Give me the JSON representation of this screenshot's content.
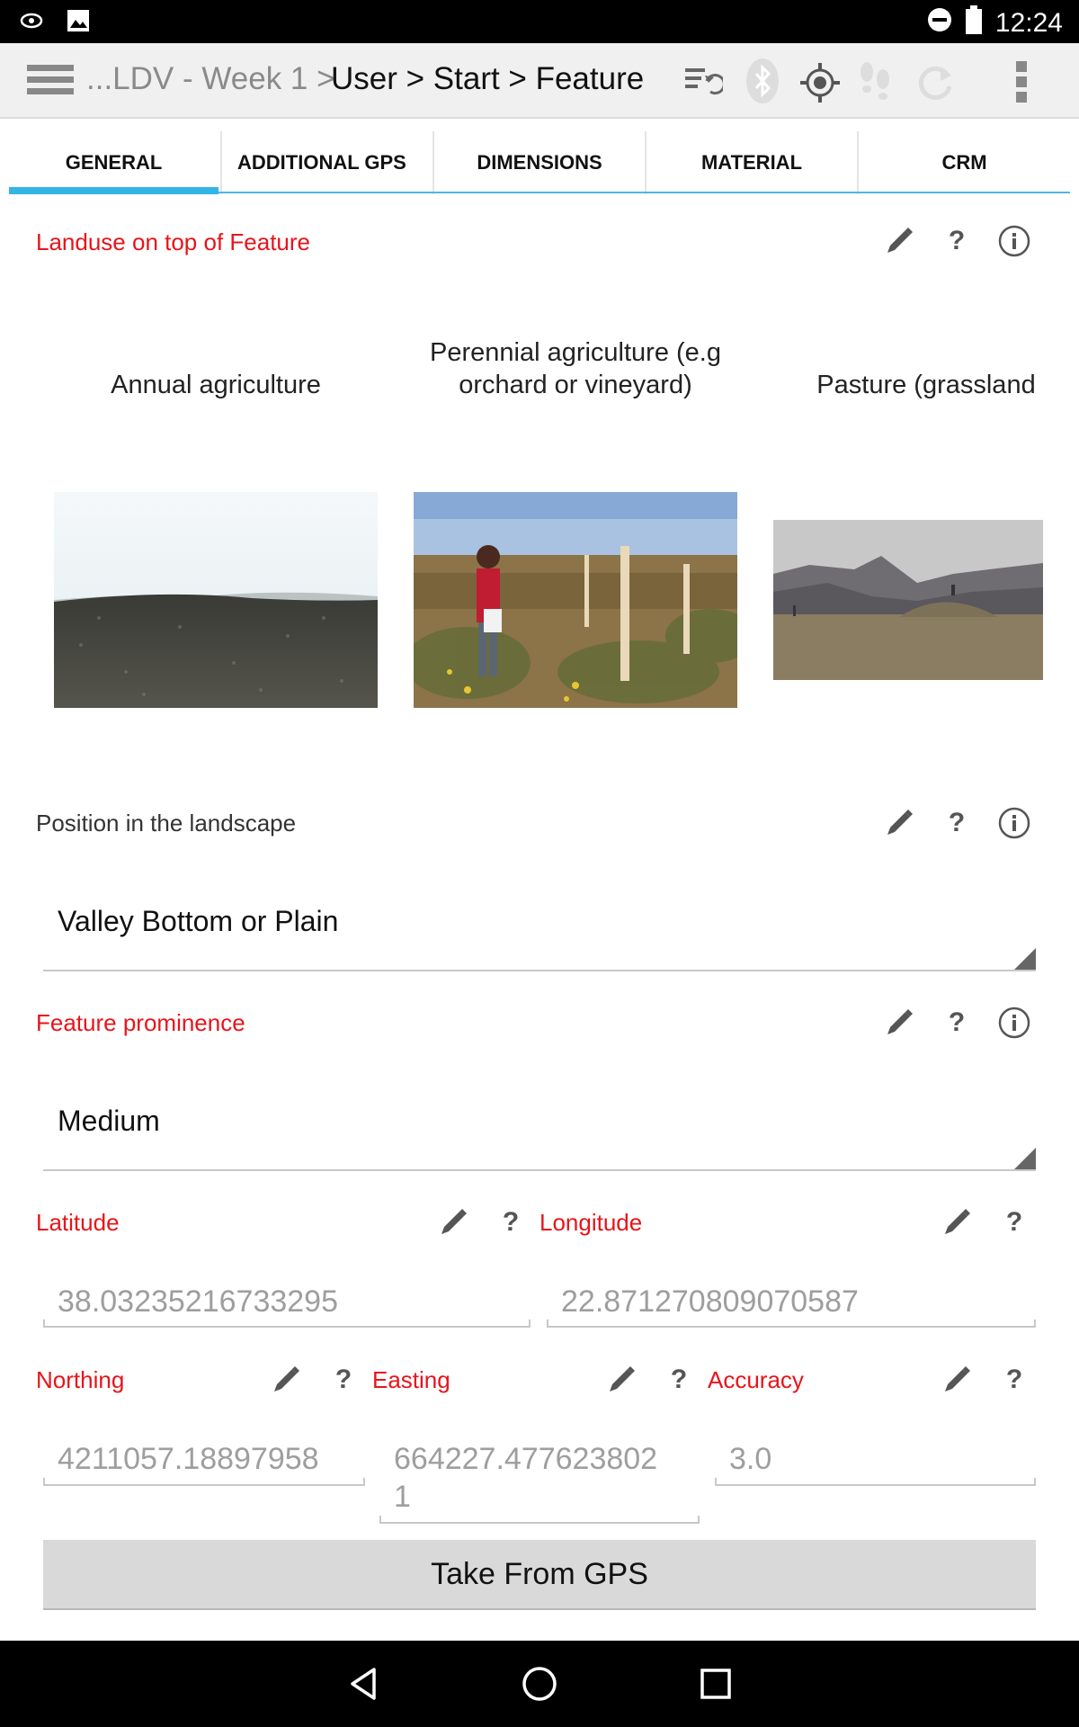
{
  "status_bar": {
    "time": "12:24",
    "left_icons": [
      "nvidia-icon",
      "image-icon"
    ],
    "right_icons": [
      "do-not-disturb-icon",
      "battery-icon"
    ]
  },
  "app_bar": {
    "breadcrumb_prefix": "...LDV - Week 1 >",
    "breadcrumb_active": "User > Start > Feature",
    "icons": [
      "menu-icon",
      "sync-list-icon",
      "bluetooth-icon",
      "gps-locate-icon",
      "footsteps-icon",
      "refresh-icon",
      "overflow-icon"
    ]
  },
  "tabs": [
    {
      "label": "GENERAL",
      "active": true
    },
    {
      "label": "ADDITIONAL GPS",
      "active": false
    },
    {
      "label": "DIMENSIONS",
      "active": false
    },
    {
      "label": "MATERIAL",
      "active": false
    },
    {
      "label": "CRM",
      "active": false
    }
  ],
  "landuse": {
    "label": "Landuse on top of Feature",
    "options": [
      {
        "caption": "Annual agriculture"
      },
      {
        "caption": "Perennial agriculture (e.g orchard or vineyard)"
      },
      {
        "caption": "Pasture (grassland"
      }
    ]
  },
  "position": {
    "label": "Position in the landscape",
    "value": "Valley Bottom or Plain"
  },
  "prominence": {
    "label": "Feature prominence",
    "value": "Medium"
  },
  "coords": {
    "latitude_label": "Latitude",
    "latitude_value": "38.03235216733295",
    "longitude_label": "Longitude",
    "longitude_value": "22.871270809070587",
    "northing_label": "Northing",
    "northing_value": "4211057.18897958",
    "easting_label": "Easting",
    "easting_value_line1": "664227.477623802",
    "easting_value_line2": "1",
    "accuracy_label": "Accuracy",
    "accuracy_value": "3.0"
  },
  "gps_button": "Take From GPS",
  "colors": {
    "required_label": "#e8141a",
    "tab_accent": "#33b5e5",
    "button_bg": "#d9d9d9"
  }
}
